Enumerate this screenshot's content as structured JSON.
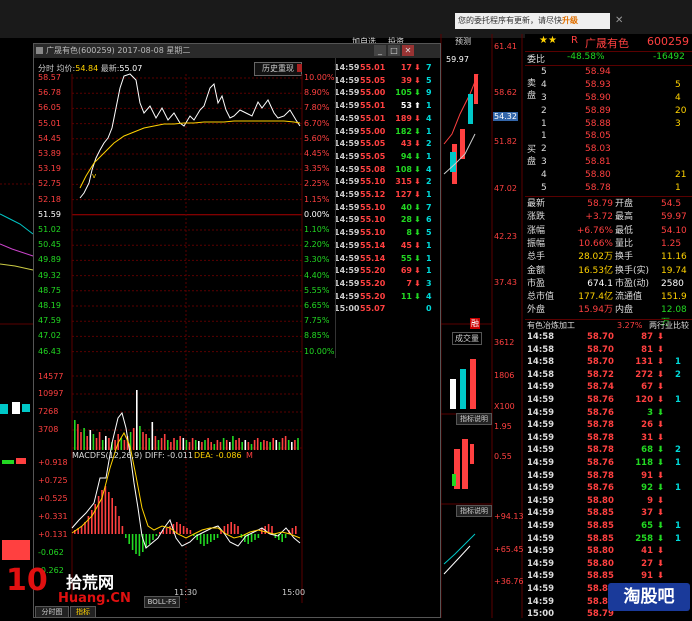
{
  "notice": {
    "text": "您的委托程序有更新，请尽快",
    "action": "升级"
  },
  "bg_chart": {
    "prices": [
      "61.41",
      "58.62",
      "51.82",
      "47.02",
      "42.23",
      "37.43"
    ],
    "small_labels": [
      "加自选",
      "投资",
      "预测"
    ],
    "subinfo": [
      "3612",
      "1806",
      "X100",
      "1.95",
      "0.55"
    ],
    "macd_vals": [
      "+94.13",
      "+65.45",
      "+36.76"
    ],
    "tag": "指标说明",
    "tag2": "指标说明",
    "ind": "成交量",
    "ind_red": "融",
    "px1": "59.97",
    "px2": "54.32"
  },
  "window": {
    "title": "广晟有色(600259) 2017-08-08 星期二",
    "info_label": "分时",
    "avg_label": "均价:",
    "avg": "54.84",
    "last_label": "最新:",
    "last": "55.07",
    "hist_btn": "历史重现",
    "left_axis": [
      "58.57",
      "56.78",
      "56.05",
      "55.01",
      "54.45",
      "53.89",
      "53.19",
      "52.75",
      "52.18",
      "51.59",
      "51.02",
      "50.45",
      "49.89",
      "49.32",
      "48.75",
      "48.19",
      "47.59",
      "47.02",
      "46.43"
    ],
    "right_axis": [
      "10.00%",
      "8.90%",
      "7.80%",
      "6.70%",
      "5.60%",
      "4.45%",
      "3.35%",
      "2.25%",
      "1.15%",
      "0.00%",
      "1.10%",
      "2.20%",
      "3.30%",
      "4.40%",
      "5.55%",
      "6.65%",
      "7.75%",
      "8.85%",
      "10.00%"
    ],
    "vol_axis": [
      "14577",
      "10997",
      "7268",
      "3708"
    ],
    "macd_label": "MACDFS(12,26,9) DIFF: -0.011",
    "dea_label": "DEA: -0.086",
    "macd_m": "M",
    "macd_axis": [
      "+0.918",
      "+0.725",
      "+0.525",
      "+0.331",
      "+0.131",
      "-0.062",
      "-0.262"
    ],
    "time_labels": [
      "11:30",
      "15:00"
    ],
    "ticks": [
      {
        "t": "14:59",
        "p": "55.01",
        "v": "17",
        "d": "7",
        "c": "red",
        "dir": "down"
      },
      {
        "t": "14:59",
        "p": "55.05",
        "v": "39",
        "d": "5",
        "c": "red",
        "dir": "down"
      },
      {
        "t": "14:59",
        "p": "55.00",
        "v": "105",
        "d": "9",
        "c": "green",
        "dir": "down"
      },
      {
        "t": "14:59",
        "p": "55.01",
        "v": "53",
        "d": "1",
        "c": "white",
        "dir": "up"
      },
      {
        "t": "14:59",
        "p": "55.01",
        "v": "189",
        "d": "4",
        "c": "red",
        "dir": "down"
      },
      {
        "t": "14:59",
        "p": "55.00",
        "v": "182",
        "d": "1",
        "c": "green",
        "dir": "down"
      },
      {
        "t": "14:59",
        "p": "55.05",
        "v": "43",
        "d": "2",
        "c": "red",
        "dir": "down"
      },
      {
        "t": "14:59",
        "p": "55.05",
        "v": "94",
        "d": "1",
        "c": "green",
        "dir": "down"
      },
      {
        "t": "14:59",
        "p": "55.08",
        "v": "108",
        "d": "4",
        "c": "green",
        "dir": "down"
      },
      {
        "t": "14:59",
        "p": "55.10",
        "v": "315",
        "d": "2",
        "c": "red",
        "dir": "down"
      },
      {
        "t": "14:59",
        "p": "55.12",
        "v": "127",
        "d": "1",
        "c": "red",
        "dir": "down"
      },
      {
        "t": "14:59",
        "p": "55.10",
        "v": "40",
        "d": "7",
        "c": "green",
        "dir": "down"
      },
      {
        "t": "14:59",
        "p": "55.10",
        "v": "28",
        "d": "6",
        "c": "green",
        "dir": "down"
      },
      {
        "t": "14:59",
        "p": "55.10",
        "v": "8",
        "d": "5",
        "c": "green",
        "dir": "down"
      },
      {
        "t": "14:59",
        "p": "55.14",
        "v": "45",
        "d": "1",
        "c": "red",
        "dir": "down"
      },
      {
        "t": "14:59",
        "p": "55.14",
        "v": "55",
        "d": "1",
        "c": "green",
        "dir": "down"
      },
      {
        "t": "14:59",
        "p": "55.20",
        "v": "69",
        "d": "1",
        "c": "red",
        "dir": "down"
      },
      {
        "t": "14:59",
        "p": "55.20",
        "v": "7",
        "d": "3",
        "c": "red",
        "dir": "down"
      },
      {
        "t": "14:59",
        "p": "55.20",
        "v": "11",
        "d": "4",
        "c": "green",
        "dir": "down"
      },
      {
        "t": "15:00",
        "p": "55.07",
        "v": "",
        "d": "0",
        "c": "red",
        "dir": "none"
      }
    ]
  },
  "panel": {
    "name": "广晟有色",
    "code": "600259",
    "star": "★★",
    "r": "R",
    "weibi_label": "委比",
    "weibi": "-48.58%",
    "weicha": "-16492",
    "sell_label": "卖盘",
    "buy_label": "买盘",
    "sells": [
      {
        "n": "5",
        "p": "58.94",
        "v": ""
      },
      {
        "n": "4",
        "p": "58.93",
        "v": "5"
      },
      {
        "n": "3",
        "p": "58.90",
        "v": "4"
      },
      {
        "n": "2",
        "p": "58.89",
        "v": "20"
      },
      {
        "n": "1",
        "p": "58.88",
        "v": "3"
      }
    ],
    "buys": [
      {
        "n": "1",
        "p": "58.05",
        "v": ""
      },
      {
        "n": "2",
        "p": "58.03",
        "v": ""
      },
      {
        "n": "3",
        "p": "58.81",
        "v": ""
      },
      {
        "n": "4",
        "p": "58.80",
        "v": "21"
      },
      {
        "n": "5",
        "p": "58.78",
        "v": "1"
      }
    ],
    "stats": [
      {
        "l1": "最新",
        "v1": "58.79",
        "c1": "red",
        "l2": "开盘",
        "v2": "54.5",
        "c2": "red"
      },
      {
        "l1": "涨跌",
        "v1": "+3.72",
        "c1": "red",
        "l2": "最高",
        "v2": "59.97",
        "c2": "red"
      },
      {
        "l1": "涨幅",
        "v1": "+6.76%",
        "c1": "red",
        "l2": "最低",
        "v2": "54.10",
        "c2": "red"
      },
      {
        "l1": "振幅",
        "v1": "10.66%",
        "c1": "red",
        "l2": "量比",
        "v2": "1.25",
        "c2": "red"
      },
      {
        "l1": "总手",
        "v1": "28.02万",
        "c1": "yellow",
        "l2": "换手",
        "v2": "11.16",
        "c2": "yellow"
      },
      {
        "l1": "金额",
        "v1": "16.53亿",
        "c1": "yellow",
        "l2": "换手(实)",
        "v2": "19.74",
        "c2": "yellow"
      },
      {
        "l1": "市盈",
        "v1": "674.1",
        "c1": "white",
        "l2": "市盈(动)",
        "v2": "2580",
        "c2": "white"
      },
      {
        "l1": "总市值",
        "v1": "177.4亿",
        "c1": "yellow",
        "l2": "流通值",
        "v2": "151.9",
        "c2": "yellow"
      },
      {
        "l1": "外盘",
        "v1": "15.94万",
        "c1": "red",
        "l2": "内盘",
        "v2": "12.08万",
        "c2": "green"
      }
    ],
    "industry": "有色冶炼加工",
    "industry_chg": "3.27%",
    "industry_cmp": "两行业比较",
    "ticks": [
      {
        "t": "14:58",
        "p": "58.70",
        "v": "87",
        "d": "",
        "c": "red",
        "dir": "down"
      },
      {
        "t": "14:58",
        "p": "58.70",
        "v": "81",
        "d": "",
        "c": "red",
        "dir": "down"
      },
      {
        "t": "14:58",
        "p": "58.70",
        "v": "131",
        "d": "1",
        "c": "red",
        "dir": "down"
      },
      {
        "t": "14:58",
        "p": "58.72",
        "v": "272",
        "d": "2",
        "c": "red",
        "dir": "down"
      },
      {
        "t": "14:59",
        "p": "58.74",
        "v": "67",
        "d": "",
        "c": "red",
        "dir": "down"
      },
      {
        "t": "14:59",
        "p": "58.76",
        "v": "120",
        "d": "1",
        "c": "red",
        "dir": "down"
      },
      {
        "t": "14:59",
        "p": "58.76",
        "v": "3",
        "d": "",
        "c": "green",
        "dir": "down"
      },
      {
        "t": "14:59",
        "p": "58.78",
        "v": "26",
        "d": "",
        "c": "red",
        "dir": "down"
      },
      {
        "t": "14:59",
        "p": "58.78",
        "v": "31",
        "d": "",
        "c": "red",
        "dir": "down"
      },
      {
        "t": "14:59",
        "p": "58.78",
        "v": "68",
        "d": "2",
        "c": "green",
        "dir": "down"
      },
      {
        "t": "14:59",
        "p": "58.76",
        "v": "118",
        "d": "1",
        "c": "green",
        "dir": "down"
      },
      {
        "t": "14:59",
        "p": "58.78",
        "v": "91",
        "d": "",
        "c": "red",
        "dir": "down"
      },
      {
        "t": "14:59",
        "p": "58.76",
        "v": "92",
        "d": "1",
        "c": "green",
        "dir": "down"
      },
      {
        "t": "14:59",
        "p": "58.80",
        "v": "9",
        "d": "",
        "c": "red",
        "dir": "down"
      },
      {
        "t": "14:59",
        "p": "58.85",
        "v": "37",
        "d": "",
        "c": "red",
        "dir": "down"
      },
      {
        "t": "14:59",
        "p": "58.85",
        "v": "65",
        "d": "1",
        "c": "green",
        "dir": "down"
      },
      {
        "t": "14:59",
        "p": "58.85",
        "v": "258",
        "d": "1",
        "c": "green",
        "dir": "down"
      },
      {
        "t": "14:59",
        "p": "58.80",
        "v": "41",
        "d": "",
        "c": "red",
        "dir": "down"
      },
      {
        "t": "14:59",
        "p": "58.80",
        "v": "27",
        "d": "",
        "c": "red",
        "dir": "down"
      },
      {
        "t": "14:59",
        "p": "58.85",
        "v": "91",
        "d": "",
        "c": "red",
        "dir": "down"
      },
      {
        "t": "14:59",
        "p": "58.85",
        "v": "3",
        "d": "",
        "c": "red",
        "dir": "down"
      },
      {
        "t": "14:59",
        "p": "58.81",
        "v": "",
        "d": "",
        "c": "red",
        "dir": "none"
      },
      {
        "t": "15:00",
        "p": "58.79",
        "v": "",
        "d": "",
        "c": "red",
        "dir": "none"
      }
    ]
  },
  "bottom_tabs": [
    "分时图",
    "指标",
    "BOLL-FS"
  ],
  "watermark_left": {
    "big": "10",
    "cn": "拾荒网",
    "en": "Huang.CN"
  },
  "watermark_right": "淘股吧",
  "colors": {
    "up": "#ff4040",
    "down": "#22d822",
    "bg": "#000000",
    "grid": "#5a0000",
    "avg": "#ffd200"
  }
}
